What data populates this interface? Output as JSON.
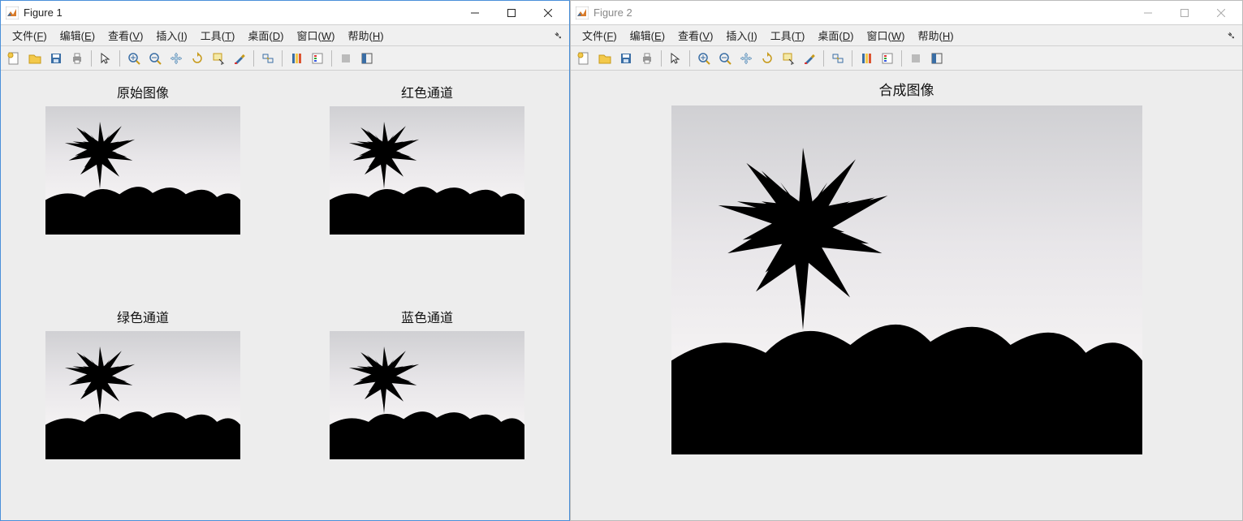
{
  "windows": [
    {
      "title": "Figure 1",
      "active": true,
      "menus": [
        {
          "label": "文件",
          "key": "F"
        },
        {
          "label": "编辑",
          "key": "E"
        },
        {
          "label": "查看",
          "key": "V"
        },
        {
          "label": "插入",
          "key": "I"
        },
        {
          "label": "工具",
          "key": "T"
        },
        {
          "label": "桌面",
          "key": "D"
        },
        {
          "label": "窗口",
          "key": "W"
        },
        {
          "label": "帮助",
          "key": "H"
        }
      ],
      "subplots": [
        {
          "title": "原始图像",
          "variant": "color"
        },
        {
          "title": "红色通道",
          "variant": "red"
        },
        {
          "title": "绿色通道",
          "variant": "green"
        },
        {
          "title": "蓝色通道",
          "variant": "blue"
        }
      ]
    },
    {
      "title": "Figure 2",
      "active": false,
      "menus": [
        {
          "label": "文件",
          "key": "F"
        },
        {
          "label": "编辑",
          "key": "E"
        },
        {
          "label": "查看",
          "key": "V"
        },
        {
          "label": "插入",
          "key": "I"
        },
        {
          "label": "工具",
          "key": "T"
        },
        {
          "label": "桌面",
          "key": "D"
        },
        {
          "label": "窗口",
          "key": "W"
        },
        {
          "label": "帮助",
          "key": "H"
        }
      ],
      "single": {
        "title": "合成图像",
        "variant": "color"
      }
    }
  ],
  "toolbar_icons": [
    "new-file",
    "open-file",
    "save",
    "print",
    "sep",
    "pointer",
    "sep",
    "zoom-in",
    "zoom-out",
    "pan",
    "rotate",
    "data-cursor",
    "brush",
    "sep",
    "link",
    "sep",
    "colorbar",
    "legend",
    "sep",
    "hide",
    "dock"
  ]
}
